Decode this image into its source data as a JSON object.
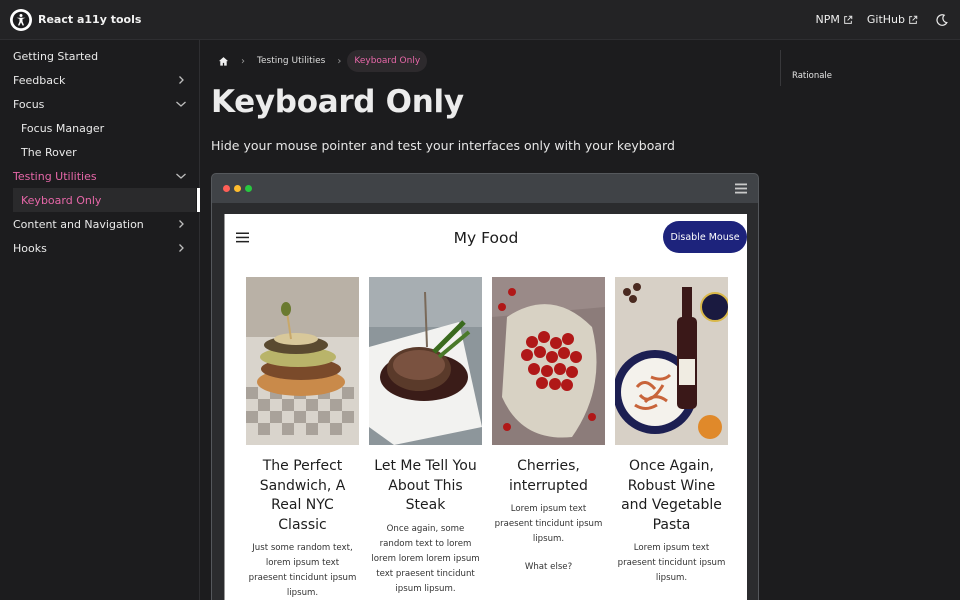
{
  "header": {
    "title": "React a11y tools",
    "links": [
      {
        "label": "NPM",
        "icon": "external-link-icon"
      },
      {
        "label": "GitHub",
        "icon": "external-link-icon"
      }
    ],
    "theme_icon": "moon-icon"
  },
  "sidebar": {
    "items": [
      {
        "label": "Getting Started"
      },
      {
        "label": "Feedback",
        "chevron": "right"
      },
      {
        "label": "Focus",
        "chevron": "down"
      },
      {
        "label": "Focus Manager"
      },
      {
        "label": "The Rover"
      },
      {
        "label": "Testing Utilities",
        "chevron": "down"
      },
      {
        "label": "Keyboard Only"
      },
      {
        "label": "Content and Navigation",
        "chevron": "right"
      },
      {
        "label": "Hooks",
        "chevron": "right"
      }
    ],
    "accent_color": "#e667a8"
  },
  "breadcrumb": {
    "home_icon": "home-icon",
    "items": [
      "Testing Utilities",
      "Keyboard Only"
    ]
  },
  "page": {
    "title": "Keyboard Only",
    "lead": "Hide your mouse pointer and test your interfaces only with your keyboard"
  },
  "demo": {
    "window_dots": [
      "#ff5f57",
      "#febc2e",
      "#28c840"
    ],
    "title": "My Food",
    "button_label": "Disable Mouse",
    "button_color": "#1d237c",
    "cards": [
      {
        "title": "The Perfect Sandwich, A Real NYC Classic",
        "text": "Just some random text, lorem ipsum text praesent tincidunt ipsum lipsum.",
        "image": "sandwich-photo"
      },
      {
        "title": "Let Me Tell You About This Steak",
        "text": "Once again, some random text to lorem lorem lorem lorem ipsum text praesent tincidunt ipsum lipsum.",
        "image": "steak-photo"
      },
      {
        "title": "Cherries, interrupted",
        "text": "Lorem ipsum text praesent tincidunt ipsum lipsum.",
        "extra": "What else?",
        "image": "cherries-photo"
      },
      {
        "title": "Once Again, Robust Wine and Vegetable Pasta",
        "text": "Lorem ipsum text praesent tincidunt ipsum lipsum.",
        "image": "wine-pasta-photo"
      }
    ]
  },
  "toc": {
    "items": [
      "Rationale"
    ]
  }
}
